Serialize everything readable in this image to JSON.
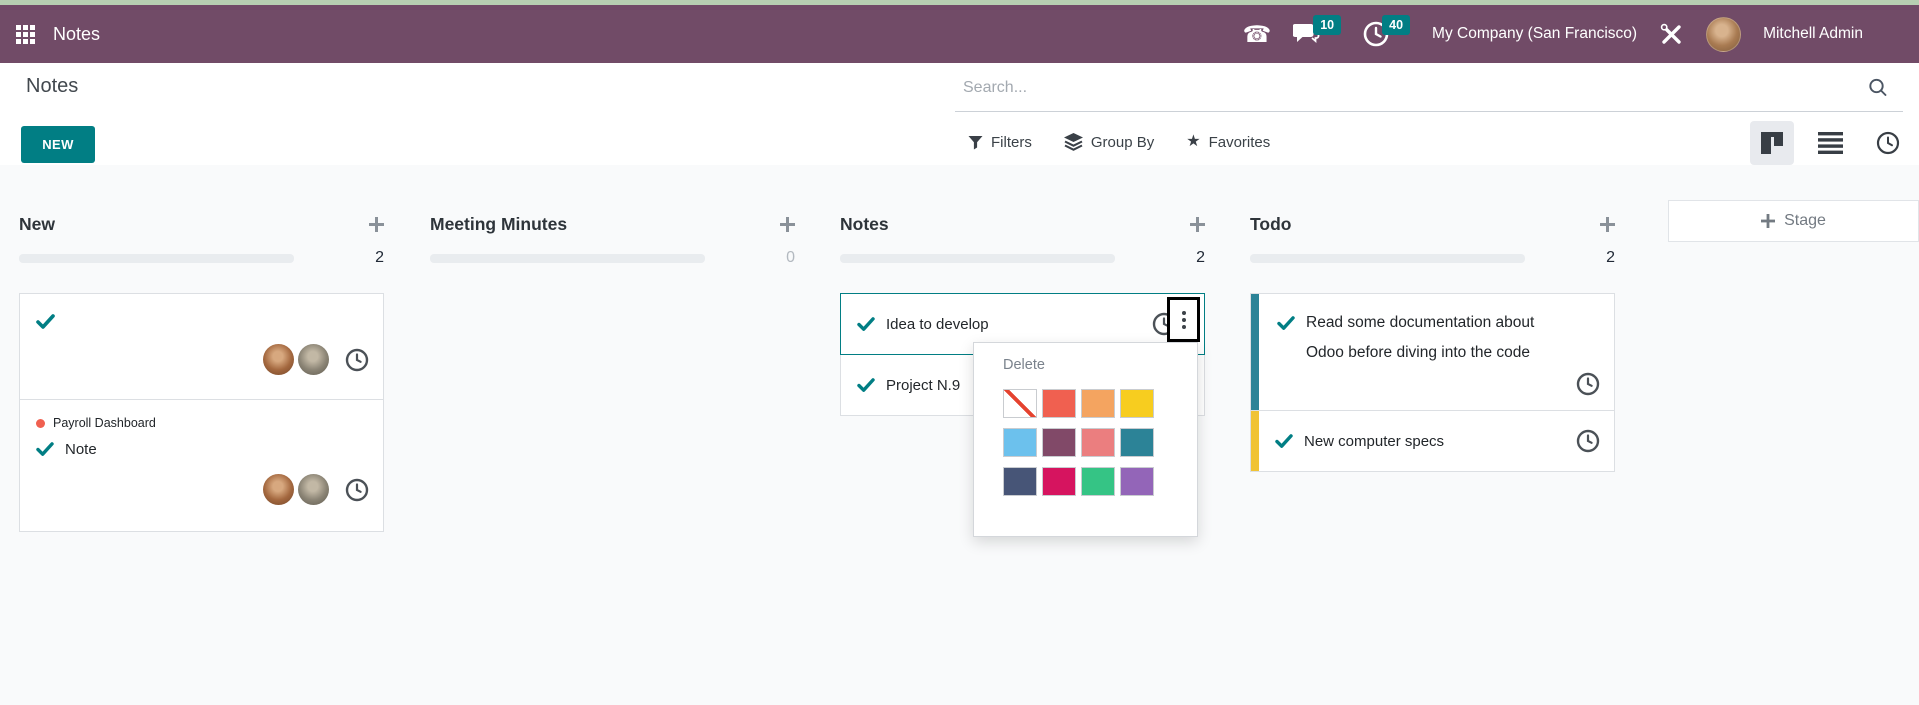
{
  "topbar": {
    "app_title": "Notes",
    "messages_badge": "10",
    "activities_badge": "40",
    "company": "My Company (San Francisco)",
    "user": "Mitchell Admin"
  },
  "control_panel": {
    "breadcrumb": "Notes",
    "new_button": "NEW",
    "search_placeholder": "Search...",
    "filters_label": "Filters",
    "group_by_label": "Group By",
    "favorites_label": "Favorites"
  },
  "board": {
    "add_stage_label": "Stage",
    "columns": [
      {
        "title": "New",
        "count": "2",
        "cards": [
          {
            "tag": "",
            "title": ""
          },
          {
            "tag": "Payroll Dashboard",
            "title": "Note"
          }
        ]
      },
      {
        "title": "Meeting Minutes",
        "count": "0",
        "cards": []
      },
      {
        "title": "Notes",
        "count": "2",
        "cards": [
          {
            "title": "Idea to develop"
          },
          {
            "title": "Project N.9"
          }
        ]
      },
      {
        "title": "Todo",
        "count": "2",
        "cards": [
          {
            "title": "Read some documentation about Odoo before diving into the code",
            "color": "#2C8397"
          },
          {
            "title": "New computer specs",
            "color": "#F0C335"
          }
        ]
      }
    ]
  },
  "context_menu": {
    "delete_label": "Delete",
    "colors": [
      "none",
      "#F06050",
      "#F4A460",
      "#F7CD1F",
      "#6CC1ED",
      "#814968",
      "#EB7E7F",
      "#2C8397",
      "#475577",
      "#D6145F",
      "#35C485",
      "#9365B8"
    ]
  },
  "theme": {
    "topbar_color": "#714B67",
    "accent_color": "#017e84",
    "badge_color": "#017e84",
    "board_background": "#f9fafb"
  }
}
